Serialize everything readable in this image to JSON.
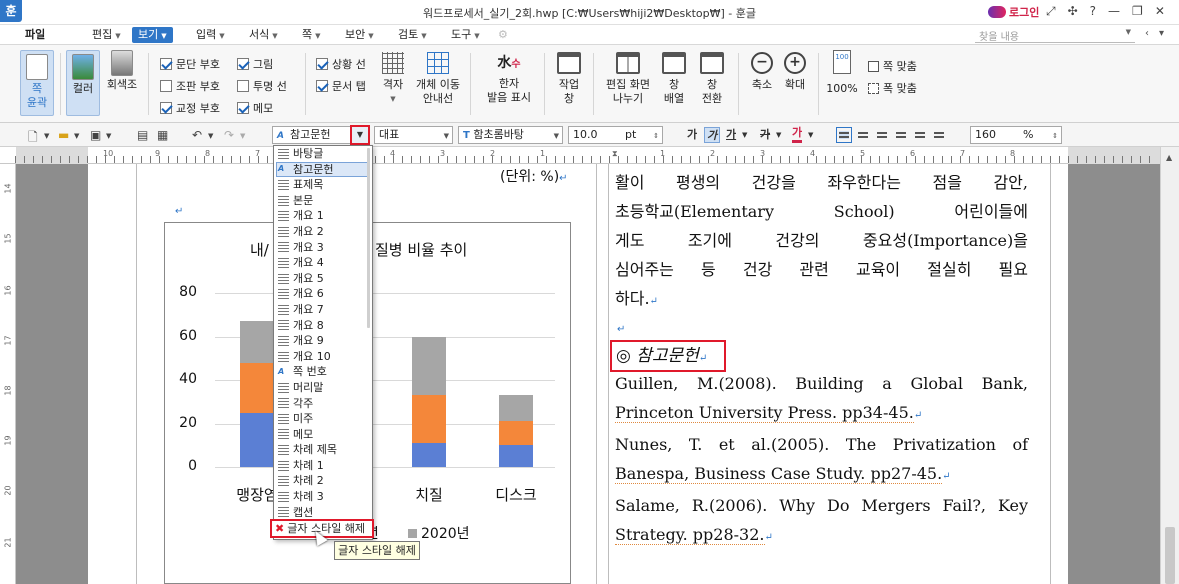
{
  "window": {
    "logo": "훈",
    "title": "워드프로세서_실기_2회.hwp [C:₩Users₩hiji2₩Desktop₩] - 훈글",
    "login": "로그인",
    "controls": [
      "⤢",
      "✣",
      "?",
      "—",
      "❐",
      "✕"
    ]
  },
  "menu": {
    "items": [
      {
        "label": "파일"
      },
      {
        "label": "편집"
      },
      {
        "label": "보기"
      },
      {
        "label": "입력"
      },
      {
        "label": "서식"
      },
      {
        "label": "쪽"
      },
      {
        "label": "보안"
      },
      {
        "label": "검토"
      },
      {
        "label": "도구"
      }
    ],
    "search_placeholder": "찾을 내용"
  },
  "ribbon": {
    "page_outline": "쪽\n윤곽",
    "color": "컬러",
    "grayscale": "회색조",
    "checks": [
      {
        "label": "문단 부호",
        "checked": true
      },
      {
        "label": "조판 부호",
        "checked": false
      },
      {
        "label": "교정 부호",
        "checked": true
      },
      {
        "label": "그림",
        "checked": true
      },
      {
        "label": "투명 선",
        "checked": false
      },
      {
        "label": "메모",
        "checked": true
      },
      {
        "label": "상황 선",
        "checked": true
      },
      {
        "label": "문서 탭",
        "checked": true
      }
    ],
    "grid": "격자",
    "object_move_guide": "개체 이동\n안내선",
    "hanja_reading": "한자\n발음 표시",
    "hanja_glyph": "水",
    "hanja_sub": "수",
    "work_window": "작업\n창",
    "split_screen": "편집 화면\n나누기",
    "window_arrange": "창\n배열",
    "window_switch": "창\n전환",
    "zoom_out": "축소",
    "zoom_in": "확대",
    "zoom_100": "100%",
    "zoom_100_icon": "100",
    "fit_page": "쪽 맞춤",
    "fit_width": "폭 맞춤"
  },
  "toolbar": {
    "style_value": "참고문헌",
    "outline_value": "대표",
    "font_value": "함초롬바탕",
    "size_value": "10.0",
    "size_unit": "pt",
    "zoom_value": "160",
    "zoom_unit": "%"
  },
  "style_dropdown": {
    "items": [
      {
        "label": "바탕글",
        "kind": "para"
      },
      {
        "label": "참고문헌",
        "kind": "char",
        "selected": true
      },
      {
        "label": "표제목",
        "kind": "para"
      },
      {
        "label": "본문",
        "kind": "para"
      },
      {
        "label": "개요 1",
        "kind": "para"
      },
      {
        "label": "개요 2",
        "kind": "para"
      },
      {
        "label": "개요 3",
        "kind": "para"
      },
      {
        "label": "개요 4",
        "kind": "para"
      },
      {
        "label": "개요 5",
        "kind": "para"
      },
      {
        "label": "개요 6",
        "kind": "para"
      },
      {
        "label": "개요 7",
        "kind": "para"
      },
      {
        "label": "개요 8",
        "kind": "para"
      },
      {
        "label": "개요 9",
        "kind": "para"
      },
      {
        "label": "개요 10",
        "kind": "para"
      },
      {
        "label": "쪽 번호",
        "kind": "char"
      },
      {
        "label": "머리말",
        "kind": "para"
      },
      {
        "label": "각주",
        "kind": "para"
      },
      {
        "label": "미주",
        "kind": "para"
      },
      {
        "label": "메모",
        "kind": "para"
      },
      {
        "label": "차례 제목",
        "kind": "para"
      },
      {
        "label": "차례 1",
        "kind": "para"
      },
      {
        "label": "차례 2",
        "kind": "para"
      },
      {
        "label": "차례 3",
        "kind": "para"
      },
      {
        "label": "캡션",
        "kind": "para"
      }
    ],
    "clear_label": "글자 스타일 해제",
    "tooltip": "글자 스타일 해제"
  },
  "document": {
    "unit_note": "(단위: %)",
    "body_lines": [
      "활이 평생의 건강을 좌우한다는 점을 감안,",
      "초등학교(Elementary School) 어린이들에",
      "게도 조기에 건강의 중요성(Importance)을",
      "심어주는 등 건강 관련 교육이 절실히 필요",
      "하다."
    ],
    "ref_heading": "◎ 참고문헌",
    "ref_lines": [
      "Guillen, M.(2008). Building a Global Bank,",
      "Princeton University Press. pp34-45.",
      "Nunes, T. et al.(2005). The Privatization of",
      "Banespa, Business Case Study. pp27-45.",
      "Salame, R.(2006). Why Do Mergers Fail?, Key",
      "Strategy. pp28-32."
    ]
  },
  "chart_data": {
    "type": "bar",
    "stacked": true,
    "title_visible_left": "내/",
    "title_visible_right": "질병 비율 추이",
    "categories": [
      "맹장염",
      "",
      "치질",
      "디스크"
    ],
    "category_labels": [
      "맹장염",
      "치질",
      "디스크"
    ],
    "series": [
      {
        "name": "",
        "color": "#5b7fd4",
        "values": [
          25,
          null,
          11,
          10
        ]
      },
      {
        "name": "",
        "color": "#f4873a",
        "values": [
          23,
          null,
          22,
          11
        ]
      },
      {
        "name": "2020년",
        "color": "#a6a6a6",
        "values": [
          19,
          null,
          27,
          12
        ]
      }
    ],
    "legend_partial": [
      "5년",
      "2020년"
    ],
    "yticks": [
      0,
      20,
      40,
      60,
      80
    ],
    "ylim": [
      0,
      80
    ]
  },
  "colors": {
    "accent": "#2f76c7",
    "highlight_red": "#e0192b"
  }
}
